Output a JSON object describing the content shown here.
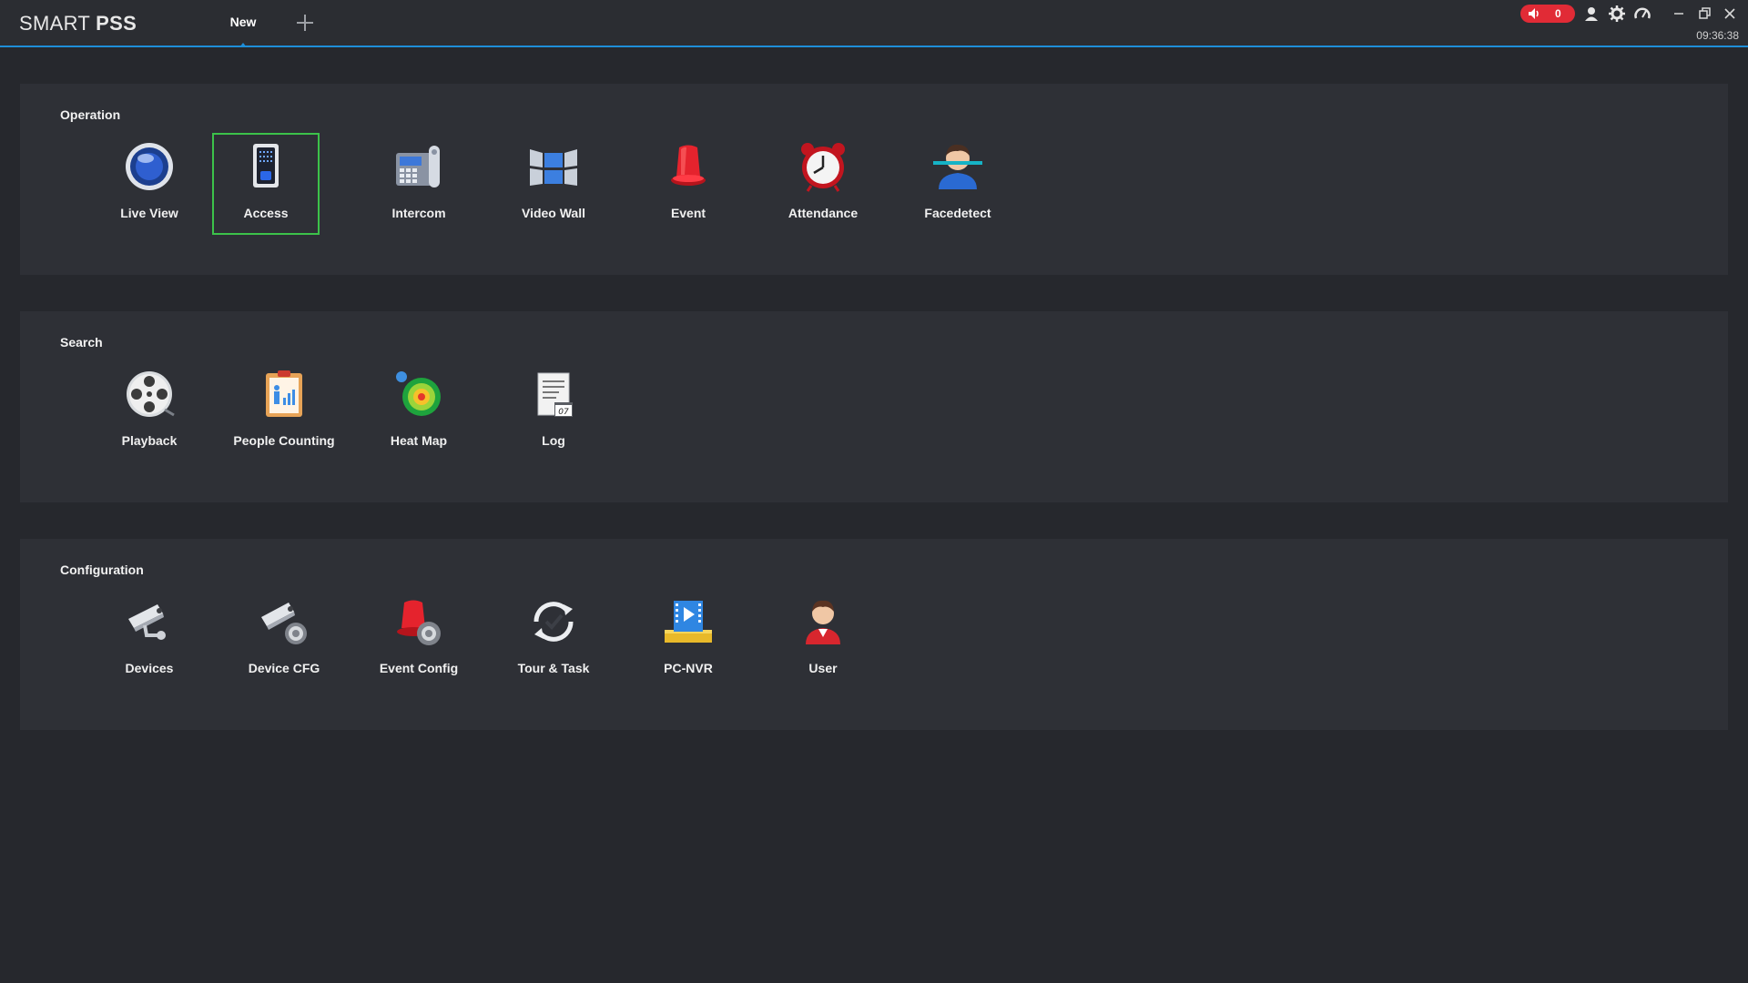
{
  "app": {
    "logo_light": "SMART ",
    "logo_bold": "PSS",
    "tab_label": "New",
    "alarm_count": "0",
    "time": "09:36:38"
  },
  "sections": {
    "operation": {
      "title": "Operation",
      "items": [
        {
          "label": "Live View",
          "icon": "live-view-icon"
        },
        {
          "label": "Access",
          "icon": "access-icon",
          "selected": true
        },
        {
          "label": "Intercom",
          "icon": "intercom-icon"
        },
        {
          "label": "Video Wall",
          "icon": "video-wall-icon"
        },
        {
          "label": "Event",
          "icon": "event-icon"
        },
        {
          "label": "Attendance",
          "icon": "attendance-icon"
        },
        {
          "label": "Facedetect",
          "icon": "facedetect-icon"
        }
      ]
    },
    "search": {
      "title": "Search",
      "items": [
        {
          "label": "Playback",
          "icon": "playback-icon"
        },
        {
          "label": "People Counting",
          "icon": "people-counting-icon"
        },
        {
          "label": "Heat Map",
          "icon": "heat-map-icon"
        },
        {
          "label": "Log",
          "icon": "log-icon"
        }
      ]
    },
    "configuration": {
      "title": "Configuration",
      "items": [
        {
          "label": "Devices",
          "icon": "devices-icon"
        },
        {
          "label": "Device CFG",
          "icon": "device-cfg-icon"
        },
        {
          "label": "Event Config",
          "icon": "event-config-icon"
        },
        {
          "label": "Tour & Task",
          "icon": "tour-task-icon"
        },
        {
          "label": "PC-NVR",
          "icon": "pc-nvr-icon"
        },
        {
          "label": "User",
          "icon": "user-icon"
        }
      ]
    }
  },
  "colors": {
    "accent": "#1e8ed8",
    "selection": "#3cc24a",
    "alarm": "#e12b36"
  }
}
